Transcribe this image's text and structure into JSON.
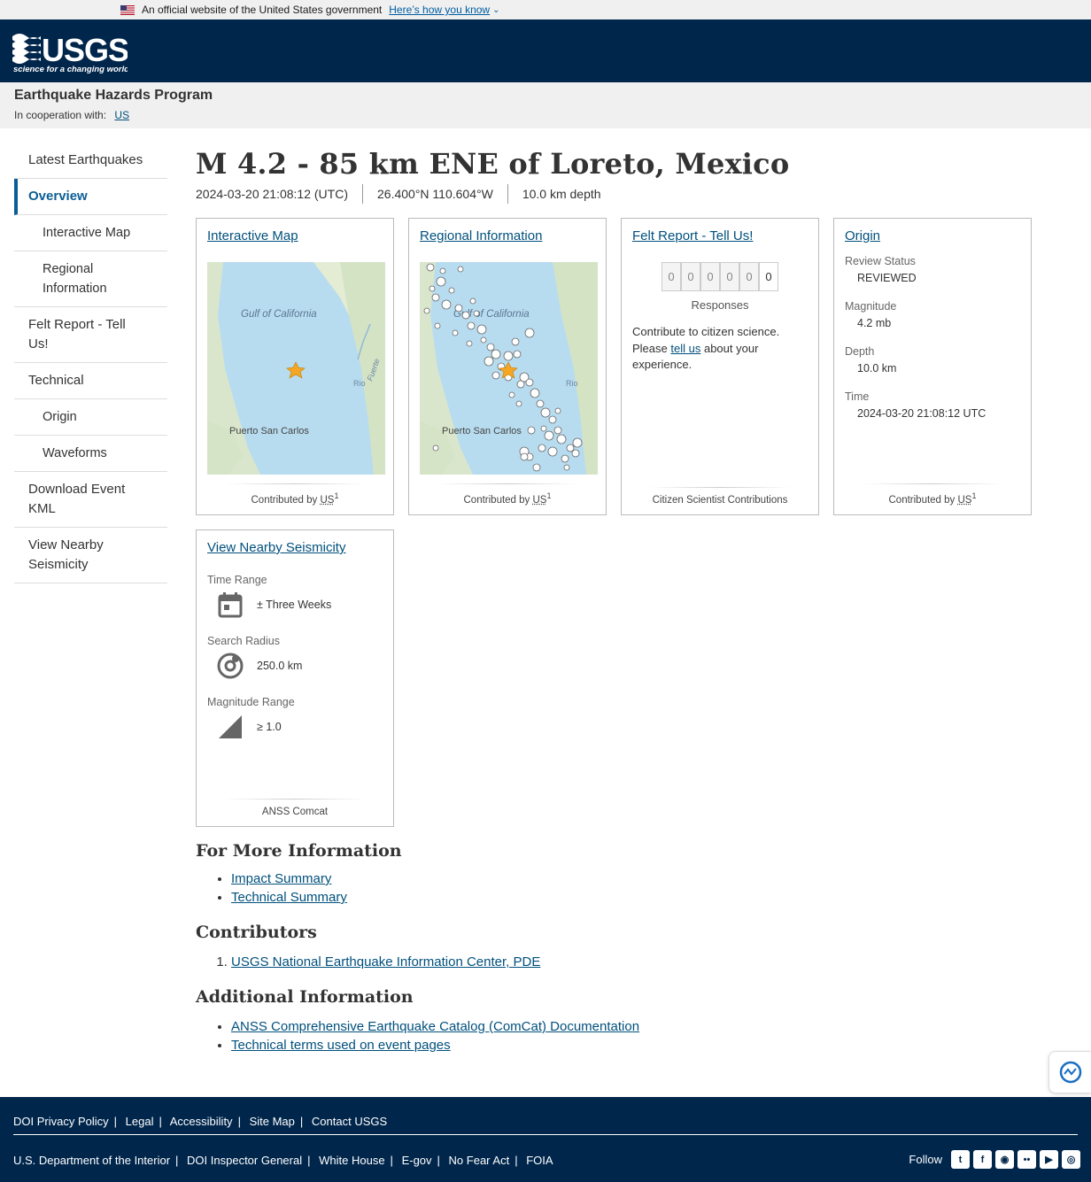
{
  "gov_banner": {
    "text": "An official website of the United States government",
    "link": "Here’s how you know"
  },
  "header": {
    "logo_text": "USGS",
    "logo_tagline": "science for a changing world"
  },
  "program": {
    "title": "Earthquake Hazards Program",
    "coop_label": "In cooperation with:",
    "coop_link": "US"
  },
  "sidebar": {
    "items": [
      {
        "label": "Latest Earthquakes"
      },
      {
        "label": "Overview"
      },
      {
        "label": "Interactive Map"
      },
      {
        "label": "Regional Information"
      },
      {
        "label": "Felt Report - Tell Us!"
      },
      {
        "label": "Technical"
      },
      {
        "label": "Origin"
      },
      {
        "label": "Waveforms"
      },
      {
        "label": "Download Event KML"
      },
      {
        "label": "View Nearby Seismicity"
      }
    ]
  },
  "event": {
    "title": "M 4.2 - 85 km ENE of Loreto, Mexico",
    "time": "2024-03-20 21:08:12 (UTC)",
    "location": "26.400°N 110.604°W",
    "depth": "10.0 km depth"
  },
  "cards": {
    "interactive_map": {
      "title": "Interactive Map",
      "footer_prefix": "Contributed by",
      "footer_net": "US",
      "footer_ref": "1",
      "map_labels": {
        "gulf": "Gulf of California",
        "town": "Puerto San Carlos",
        "rio": "Rio",
        "fuerte": "Fuerte"
      }
    },
    "regional": {
      "title": "Regional Information",
      "footer_prefix": "Contributed by",
      "footer_net": "US",
      "footer_ref": "1"
    },
    "felt": {
      "title": "Felt Report - Tell Us!",
      "digits": [
        "0",
        "0",
        "0",
        "0",
        "0",
        "0"
      ],
      "responses_label": "Responses",
      "text_before": "Contribute to citizen science. Please",
      "link": "tell us",
      "text_after": "about your experience.",
      "footer": "Citizen Scientist Contributions"
    },
    "origin": {
      "title": "Origin",
      "review_status_label": "Review Status",
      "review_status": "REVIEWED",
      "magnitude_label": "Magnitude",
      "magnitude": "4.2 mb",
      "depth_label": "Depth",
      "depth": "10.0 km",
      "time_label": "Time",
      "time": "2024-03-20 21:08:12 UTC",
      "footer_prefix": "Contributed by",
      "footer_net": "US",
      "footer_ref": "1"
    },
    "seismicity": {
      "title": "View Nearby Seismicity",
      "time_range_label": "Time Range",
      "time_range": "± Three Weeks",
      "radius_label": "Search Radius",
      "radius": "250.0 km",
      "mag_label": "Magnitude Range",
      "mag": "≥ 1.0",
      "footer": "ANSS Comcat"
    }
  },
  "more_info": {
    "heading": "For More Information",
    "links": [
      "Impact Summary",
      "Technical Summary"
    ]
  },
  "contributors": {
    "heading": "Contributors",
    "items": [
      "USGS National Earthquake Information Center, PDE"
    ]
  },
  "additional": {
    "heading": "Additional Information",
    "links": [
      "ANSS Comprehensive Earthquake Catalog (ComCat) Documentation",
      "Technical terms used on event pages"
    ]
  },
  "footer": {
    "row1": [
      "DOI Privacy Policy",
      "Legal",
      "Accessibility",
      "Site Map",
      "Contact USGS"
    ],
    "row2": [
      "U.S. Department of the Interior",
      "DOI Inspector General",
      "White House",
      "E-gov",
      "No Fear Act",
      "FOIA"
    ],
    "follow": "Follow",
    "social_icons": [
      "twitter-icon",
      "facebook-icon",
      "github-icon",
      "flickr-icon",
      "youtube-icon",
      "instagram-icon"
    ]
  },
  "colors": {
    "header_bg": "#00264c",
    "link": "#00507d",
    "active_nav": "#0b5e95",
    "map_water": "#b8dcef",
    "map_land": "#d7e4c9"
  }
}
